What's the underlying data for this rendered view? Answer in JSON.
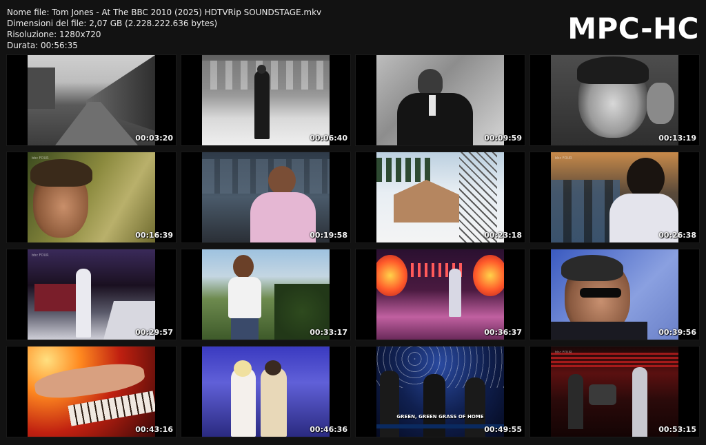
{
  "info": {
    "filename": "Nome file: Tom Jones - At The BBC 2010 (2025) HDTVRip SOUNDSTAGE.mkv",
    "filesize": "Dimensioni del file: 2,07 GB (2.228.222.636 bytes)",
    "resolution": "Risoluzione: 1280x720",
    "duration": "Durata: 00:56:35"
  },
  "logo": "MPC-HC",
  "thumbnails": [
    {
      "time": "00:03:20",
      "scene": "bw-street-terraced-houses"
    },
    {
      "time": "00:06:40",
      "scene": "bw-singer-on-stage"
    },
    {
      "time": "00:09:59",
      "scene": "bw-singer-closeup-suit"
    },
    {
      "time": "00:13:19",
      "scene": "bw-face-closeup-crowd"
    },
    {
      "time": "00:16:39",
      "scene": "color-face-profile-outdoors"
    },
    {
      "time": "00:19:58",
      "scene": "singer-pink-shirt-studio"
    },
    {
      "time": "00:23:18",
      "scene": "snowy-chalet-lift-tower"
    },
    {
      "time": "00:26:38",
      "scene": "singer-microphone-orchestra"
    },
    {
      "time": "00:29:57",
      "scene": "singer-white-outfit-stage"
    },
    {
      "time": "00:33:17",
      "scene": "man-white-vest-coast"
    },
    {
      "time": "00:36:37",
      "scene": "stage-tj-lights"
    },
    {
      "time": "00:39:56",
      "scene": "singer-sunglasses-microphone"
    },
    {
      "time": "00:43:16",
      "scene": "hands-on-piano-keys"
    },
    {
      "time": "00:46:36",
      "scene": "duet-on-stage"
    },
    {
      "time": "00:49:55",
      "scene": "guitar-band-starry-stage",
      "caption": "GREEN, GREEN GRASS OF HOME"
    },
    {
      "time": "00:53:15",
      "scene": "band-on-red-stage"
    }
  ]
}
